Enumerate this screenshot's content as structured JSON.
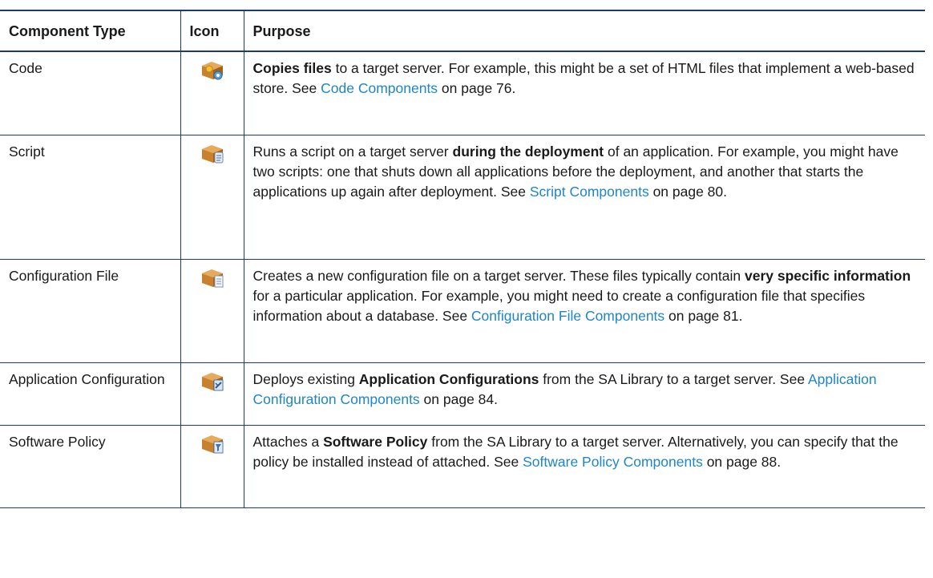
{
  "table": {
    "headers": [
      "Component Type",
      "Icon",
      "Purpose"
    ],
    "rows": [
      {
        "type": "Code",
        "icon": "code-component-icon",
        "purpose": {
          "lead": "",
          "bold": "Copies files",
          "mid": " to a target server. For example, this might be a set of HTML files that implement a web-based store. See ",
          "link": "Code Components",
          "tail": " on page 76."
        }
      },
      {
        "type": "Script",
        "icon": "script-component-icon",
        "purpose": {
          "lead": "Runs a script on a target server ",
          "bold": "during the deployment",
          "mid": " of an application. For example, you might have two scripts: one that shuts down all applications before the deployment, and another that starts the applications up again after deployment. See ",
          "link": "Script Components",
          "tail": " on page 80."
        }
      },
      {
        "type": "Configuration File",
        "icon": "configuration-file-component-icon",
        "purpose": {
          "lead": "Creates a new configuration file on a target server. These files typically contain ",
          "bold": "very specific information",
          "mid": " for a particular application. For example, you might need to create a configuration file that specifies information about a database. See ",
          "link": "Configuration File Components",
          "tail": " on page 81."
        }
      },
      {
        "type": "Application Configuration",
        "icon": "application-configuration-component-icon",
        "purpose": {
          "lead": "Deploys existing ",
          "bold": "Application Configurations",
          "mid": " from the SA Library to a target server. See ",
          "link": "Application Configuration Components",
          "tail": " on page 84."
        }
      },
      {
        "type": "Software Policy",
        "icon": "software-policy-component-icon",
        "purpose": {
          "lead": "Attaches a ",
          "bold": "Software Policy",
          "mid": " from the SA Library to a target server. Alternatively, you can specify that the policy be installed instead of attached. See ",
          "link": "Software Policy Components",
          "tail": " on page 88."
        }
      }
    ]
  },
  "colors": {
    "border": "#1f3a6e",
    "link": "#1e86c8",
    "box": "#c8822e"
  }
}
